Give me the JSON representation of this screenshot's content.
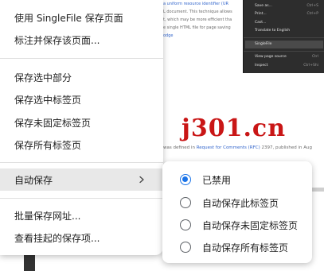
{
  "background": {
    "text_lines": [
      {
        "pre": "",
        "link": "a uniform resource identifier (UR",
        "post": ""
      },
      {
        "pre": "",
        "link": "",
        "post": "L document. This technique allows"
      },
      {
        "pre": "",
        "link": "",
        "post": "t, which may be more efficient tha"
      },
      {
        "pre": "",
        "link": "",
        "post": "e single HTML file for page saving"
      },
      {
        "pre": "",
        "link": "odge",
        "post": ""
      }
    ],
    "rfc_line": {
      "pre": "was defined in ",
      "link": "Request for Comments (RFC)",
      "post": " 2397, published in Aug"
    },
    "dark_menu": {
      "items": [
        {
          "label": "Save as...",
          "shortcut": "Ctrl+S"
        },
        {
          "label": "Print...",
          "shortcut": "Ctrl+P"
        },
        {
          "label": "Cast...",
          "shortcut": ""
        },
        {
          "label": "Translate to English",
          "shortcut": ""
        },
        {
          "label": "SingleFile",
          "shortcut": ""
        },
        {
          "label": "View page source",
          "shortcut": "Ctrl"
        },
        {
          "label": "Inspect",
          "shortcut": "Ctrl+Shi"
        }
      ]
    },
    "watermark": "j301.cn"
  },
  "context_menu": {
    "items": [
      {
        "label": "使用 SingleFile 保存页面"
      },
      {
        "label": "标注并保存该页面..."
      },
      {
        "label": "保存选中部分"
      },
      {
        "label": "保存选中标签页"
      },
      {
        "label": "保存未固定标签页"
      },
      {
        "label": "保存所有标签页"
      },
      {
        "label": "自动保存"
      },
      {
        "label": "批量保存网址..."
      },
      {
        "label": "查看挂起的保存项..."
      }
    ]
  },
  "submenu": {
    "options": [
      {
        "label": "已禁用",
        "checked": true
      },
      {
        "label": "自动保存此标签页",
        "checked": false
      },
      {
        "label": "自动保存未固定标签页",
        "checked": false
      },
      {
        "label": "自动保存所有标签页",
        "checked": false
      }
    ]
  },
  "colors": {
    "accent": "#1a73e8",
    "menu_bg": "#ffffff",
    "hover_bg": "#e8e8e8",
    "watermark": "#c91616"
  }
}
